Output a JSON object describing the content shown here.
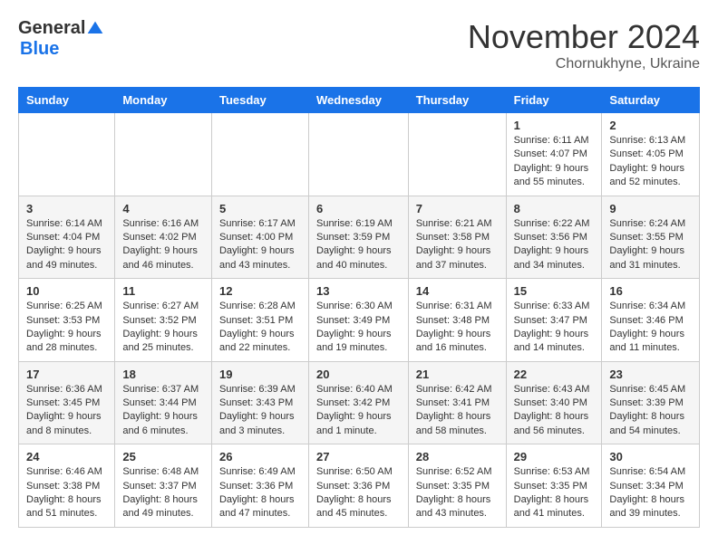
{
  "logo": {
    "general": "General",
    "blue": "Blue"
  },
  "title": "November 2024",
  "location": "Chornukhyne, Ukraine",
  "weekdays": [
    "Sunday",
    "Monday",
    "Tuesday",
    "Wednesday",
    "Thursday",
    "Friday",
    "Saturday"
  ],
  "weeks": [
    [
      {
        "day": "",
        "info": ""
      },
      {
        "day": "",
        "info": ""
      },
      {
        "day": "",
        "info": ""
      },
      {
        "day": "",
        "info": ""
      },
      {
        "day": "",
        "info": ""
      },
      {
        "day": "1",
        "info": "Sunrise: 6:11 AM\nSunset: 4:07 PM\nDaylight: 9 hours and 55 minutes."
      },
      {
        "day": "2",
        "info": "Sunrise: 6:13 AM\nSunset: 4:05 PM\nDaylight: 9 hours and 52 minutes."
      }
    ],
    [
      {
        "day": "3",
        "info": "Sunrise: 6:14 AM\nSunset: 4:04 PM\nDaylight: 9 hours and 49 minutes."
      },
      {
        "day": "4",
        "info": "Sunrise: 6:16 AM\nSunset: 4:02 PM\nDaylight: 9 hours and 46 minutes."
      },
      {
        "day": "5",
        "info": "Sunrise: 6:17 AM\nSunset: 4:00 PM\nDaylight: 9 hours and 43 minutes."
      },
      {
        "day": "6",
        "info": "Sunrise: 6:19 AM\nSunset: 3:59 PM\nDaylight: 9 hours and 40 minutes."
      },
      {
        "day": "7",
        "info": "Sunrise: 6:21 AM\nSunset: 3:58 PM\nDaylight: 9 hours and 37 minutes."
      },
      {
        "day": "8",
        "info": "Sunrise: 6:22 AM\nSunset: 3:56 PM\nDaylight: 9 hours and 34 minutes."
      },
      {
        "day": "9",
        "info": "Sunrise: 6:24 AM\nSunset: 3:55 PM\nDaylight: 9 hours and 31 minutes."
      }
    ],
    [
      {
        "day": "10",
        "info": "Sunrise: 6:25 AM\nSunset: 3:53 PM\nDaylight: 9 hours and 28 minutes."
      },
      {
        "day": "11",
        "info": "Sunrise: 6:27 AM\nSunset: 3:52 PM\nDaylight: 9 hours and 25 minutes."
      },
      {
        "day": "12",
        "info": "Sunrise: 6:28 AM\nSunset: 3:51 PM\nDaylight: 9 hours and 22 minutes."
      },
      {
        "day": "13",
        "info": "Sunrise: 6:30 AM\nSunset: 3:49 PM\nDaylight: 9 hours and 19 minutes."
      },
      {
        "day": "14",
        "info": "Sunrise: 6:31 AM\nSunset: 3:48 PM\nDaylight: 9 hours and 16 minutes."
      },
      {
        "day": "15",
        "info": "Sunrise: 6:33 AM\nSunset: 3:47 PM\nDaylight: 9 hours and 14 minutes."
      },
      {
        "day": "16",
        "info": "Sunrise: 6:34 AM\nSunset: 3:46 PM\nDaylight: 9 hours and 11 minutes."
      }
    ],
    [
      {
        "day": "17",
        "info": "Sunrise: 6:36 AM\nSunset: 3:45 PM\nDaylight: 9 hours and 8 minutes."
      },
      {
        "day": "18",
        "info": "Sunrise: 6:37 AM\nSunset: 3:44 PM\nDaylight: 9 hours and 6 minutes."
      },
      {
        "day": "19",
        "info": "Sunrise: 6:39 AM\nSunset: 3:43 PM\nDaylight: 9 hours and 3 minutes."
      },
      {
        "day": "20",
        "info": "Sunrise: 6:40 AM\nSunset: 3:42 PM\nDaylight: 9 hours and 1 minute."
      },
      {
        "day": "21",
        "info": "Sunrise: 6:42 AM\nSunset: 3:41 PM\nDaylight: 8 hours and 58 minutes."
      },
      {
        "day": "22",
        "info": "Sunrise: 6:43 AM\nSunset: 3:40 PM\nDaylight: 8 hours and 56 minutes."
      },
      {
        "day": "23",
        "info": "Sunrise: 6:45 AM\nSunset: 3:39 PM\nDaylight: 8 hours and 54 minutes."
      }
    ],
    [
      {
        "day": "24",
        "info": "Sunrise: 6:46 AM\nSunset: 3:38 PM\nDaylight: 8 hours and 51 minutes."
      },
      {
        "day": "25",
        "info": "Sunrise: 6:48 AM\nSunset: 3:37 PM\nDaylight: 8 hours and 49 minutes."
      },
      {
        "day": "26",
        "info": "Sunrise: 6:49 AM\nSunset: 3:36 PM\nDaylight: 8 hours and 47 minutes."
      },
      {
        "day": "27",
        "info": "Sunrise: 6:50 AM\nSunset: 3:36 PM\nDaylight: 8 hours and 45 minutes."
      },
      {
        "day": "28",
        "info": "Sunrise: 6:52 AM\nSunset: 3:35 PM\nDaylight: 8 hours and 43 minutes."
      },
      {
        "day": "29",
        "info": "Sunrise: 6:53 AM\nSunset: 3:35 PM\nDaylight: 8 hours and 41 minutes."
      },
      {
        "day": "30",
        "info": "Sunrise: 6:54 AM\nSunset: 3:34 PM\nDaylight: 8 hours and 39 minutes."
      }
    ]
  ]
}
